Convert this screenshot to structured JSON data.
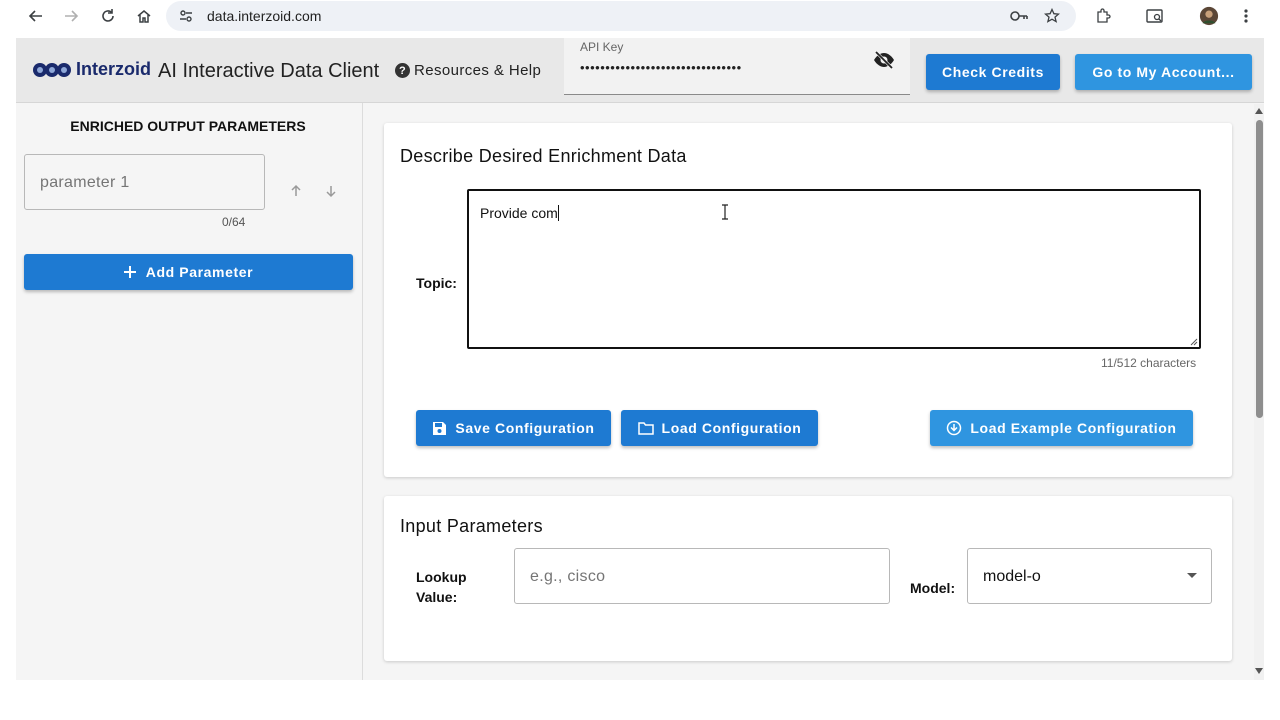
{
  "browser": {
    "url": "data.interzoid.com"
  },
  "header": {
    "logo_text": "Interzoid",
    "title": "AI Interactive Data Client",
    "help_label": "Resources & Help",
    "api_key_label": "API Key",
    "api_key_masked": "••••••••••••••••••••••••••••••••",
    "check_credits_label": "Check Credits",
    "account_label": "Go to My Account..."
  },
  "sidebar": {
    "title": "ENRICHED OUTPUT PARAMETERS",
    "parameter_placeholder": "parameter 1",
    "parameter_counter": "0/64",
    "add_parameter_label": "Add Parameter"
  },
  "enrichment": {
    "title": "Describe Desired Enrichment Data",
    "topic_label": "Topic:",
    "topic_value": "Provide com",
    "char_count": "11/512 characters",
    "save_label": "Save Configuration",
    "load_label": "Load Configuration",
    "example_label": "Load Example Configuration"
  },
  "inputs": {
    "title": "Input Parameters",
    "lookup_label_line1": "Lookup",
    "lookup_label_line2": "Value:",
    "lookup_placeholder": "e.g., cisco",
    "model_label": "Model:",
    "model_value": "model-o"
  },
  "colors": {
    "primary_button": "#1e7ad2",
    "example_button": "#2f95e0",
    "account_button": "#2f95e0"
  }
}
